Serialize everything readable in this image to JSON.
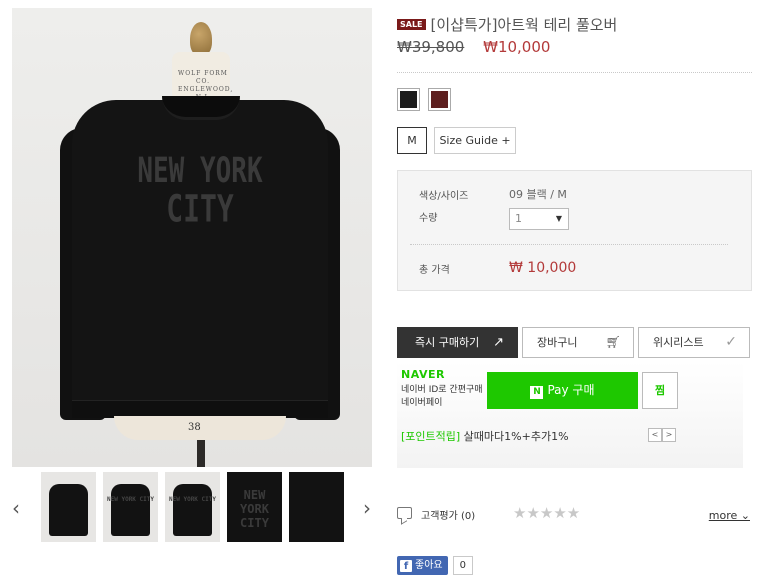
{
  "gallery": {
    "neck_tag": "WOLF FORM CO. ENGLEWOOD, N.J.",
    "print_line1": "NEW YORK",
    "print_line2": "CITY",
    "form_size": "38",
    "prev_arrow": "‹",
    "next_arrow": "›",
    "thumb_print": "NEW YORK CITY"
  },
  "product": {
    "sale_badge": "SALE",
    "title": "[이샵특가]아트웍 테리 풀오버",
    "price_original": "₩39,800",
    "price_sale": "₩10,000"
  },
  "colors": [
    {
      "name": "black",
      "hex": "#1c1c1c"
    },
    {
      "name": "wine",
      "hex": "#5e1f1f"
    }
  ],
  "sizes": {
    "selected": "M",
    "guide_label": "Size Guide +"
  },
  "option_box": {
    "color_size_label": "색상/사이즈",
    "color_size_value": "09 블랙 / M",
    "qty_label": "수량",
    "qty_value": "1",
    "total_label": "총 가격",
    "total_value": "₩ 10,000"
  },
  "actions": {
    "buy_now": "즉시 구매하기",
    "cart": "장바구니",
    "wishlist": "위시리스트"
  },
  "naverpay": {
    "brand": "NAVER",
    "desc": "네이버 ID로 간편구매 네이버페이",
    "pay_label": "Pay 구매",
    "n_logo": "N",
    "zzim": "찜",
    "point_tag": "[포인트적립]",
    "point_text": " 살때마다1%+추가1%",
    "nav_prev": "<",
    "nav_next": ">"
  },
  "review": {
    "label": "고객평가 (0)",
    "stars": "★★★★★",
    "rating": 0,
    "more": "more ⌄"
  },
  "facebook": {
    "like_label": "좋아요",
    "count": "0"
  },
  "theme": {
    "sale_red": "#b33a3a",
    "naver_green": "#1ec800",
    "facebook_blue": "#4267b2"
  }
}
